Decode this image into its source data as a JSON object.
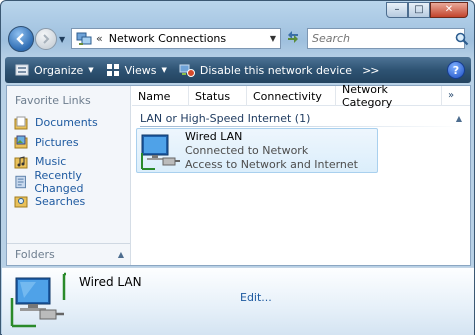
{
  "window": {
    "minimize_glyph": "–",
    "maximize_glyph": "□",
    "close_glyph": "✕"
  },
  "address_bar": {
    "separator": "«",
    "location": "Network Connections",
    "location_icon": "network-connections-icon"
  },
  "search": {
    "placeholder": "Search"
  },
  "toolbar": {
    "organize_label": "Organize",
    "views_label": "Views",
    "disable_label": "Disable this network device",
    "more_label": ">>",
    "help_label": "?"
  },
  "nav_pane": {
    "heading": "Favorite Links",
    "items": [
      {
        "label": "Documents",
        "icon": "documents-icon"
      },
      {
        "label": "Pictures",
        "icon": "pictures-icon"
      },
      {
        "label": "Music",
        "icon": "music-icon"
      },
      {
        "label": "Recently Changed",
        "icon": "recently-changed-icon"
      },
      {
        "label": "Searches",
        "icon": "searches-icon"
      }
    ],
    "folders_label": "Folders"
  },
  "columns": [
    "Name",
    "Status",
    "Connectivity",
    "Network Category"
  ],
  "group": {
    "title": "LAN or High-Speed Internet (1)"
  },
  "connection": {
    "name": "Wired LAN",
    "status": "Connected to Network",
    "access": "Access to Network and Internet"
  },
  "details": {
    "name": "Wired LAN",
    "edit_label": "Edit..."
  },
  "colors": {
    "toolbar": "#2e5373",
    "link": "#1e5aa0",
    "selection": "#dbeefb"
  }
}
